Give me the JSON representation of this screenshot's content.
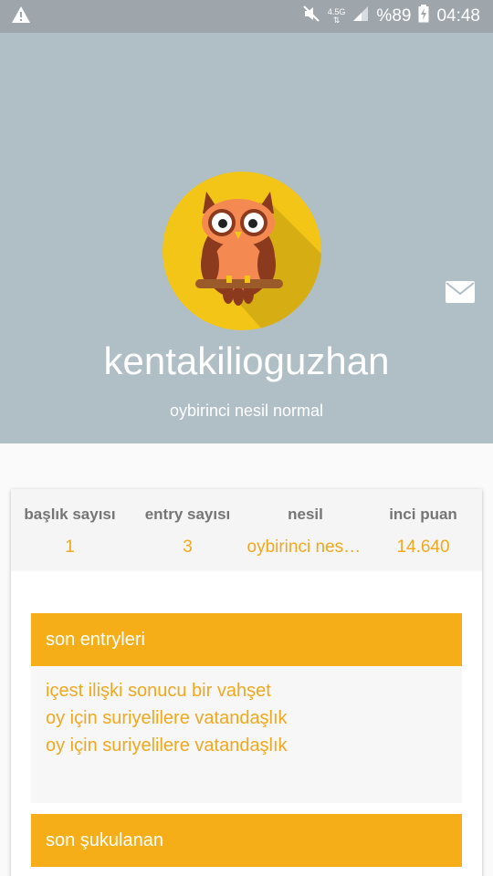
{
  "status_bar": {
    "network": "4.5G",
    "battery": "%89",
    "time": "04:48",
    "icons": [
      "warning-icon",
      "mute-icon",
      "signal-icon",
      "battery-charging-icon"
    ]
  },
  "profile": {
    "username": "kentakilioguzhan",
    "subtitle": "oybirinci nesil normal",
    "avatar": "owl-avatar",
    "message_icon": "mail-icon"
  },
  "stats": [
    {
      "label": "başlık sayısı",
      "value": "1"
    },
    {
      "label": "entry sayısı",
      "value": "3"
    },
    {
      "label": "nesil",
      "value": "oybirinci nesil normal"
    },
    {
      "label": "inci puan",
      "value": "14.640"
    }
  ],
  "sections": {
    "recent_entries": {
      "title": "son entryleri",
      "items": [
        "içest ilişki sonucu bir vahşet",
        "oy için suriyelilere vatandaşlık",
        "oy için suriyelilere vatandaşlık"
      ]
    },
    "recent_favorites": {
      "title": "son şukulanan"
    }
  },
  "colors": {
    "header_bg": "#b0bec5",
    "accent": "#f5ae18",
    "accent_text": "#f0a81e",
    "status_bar_bg": "#9ea6ac"
  }
}
